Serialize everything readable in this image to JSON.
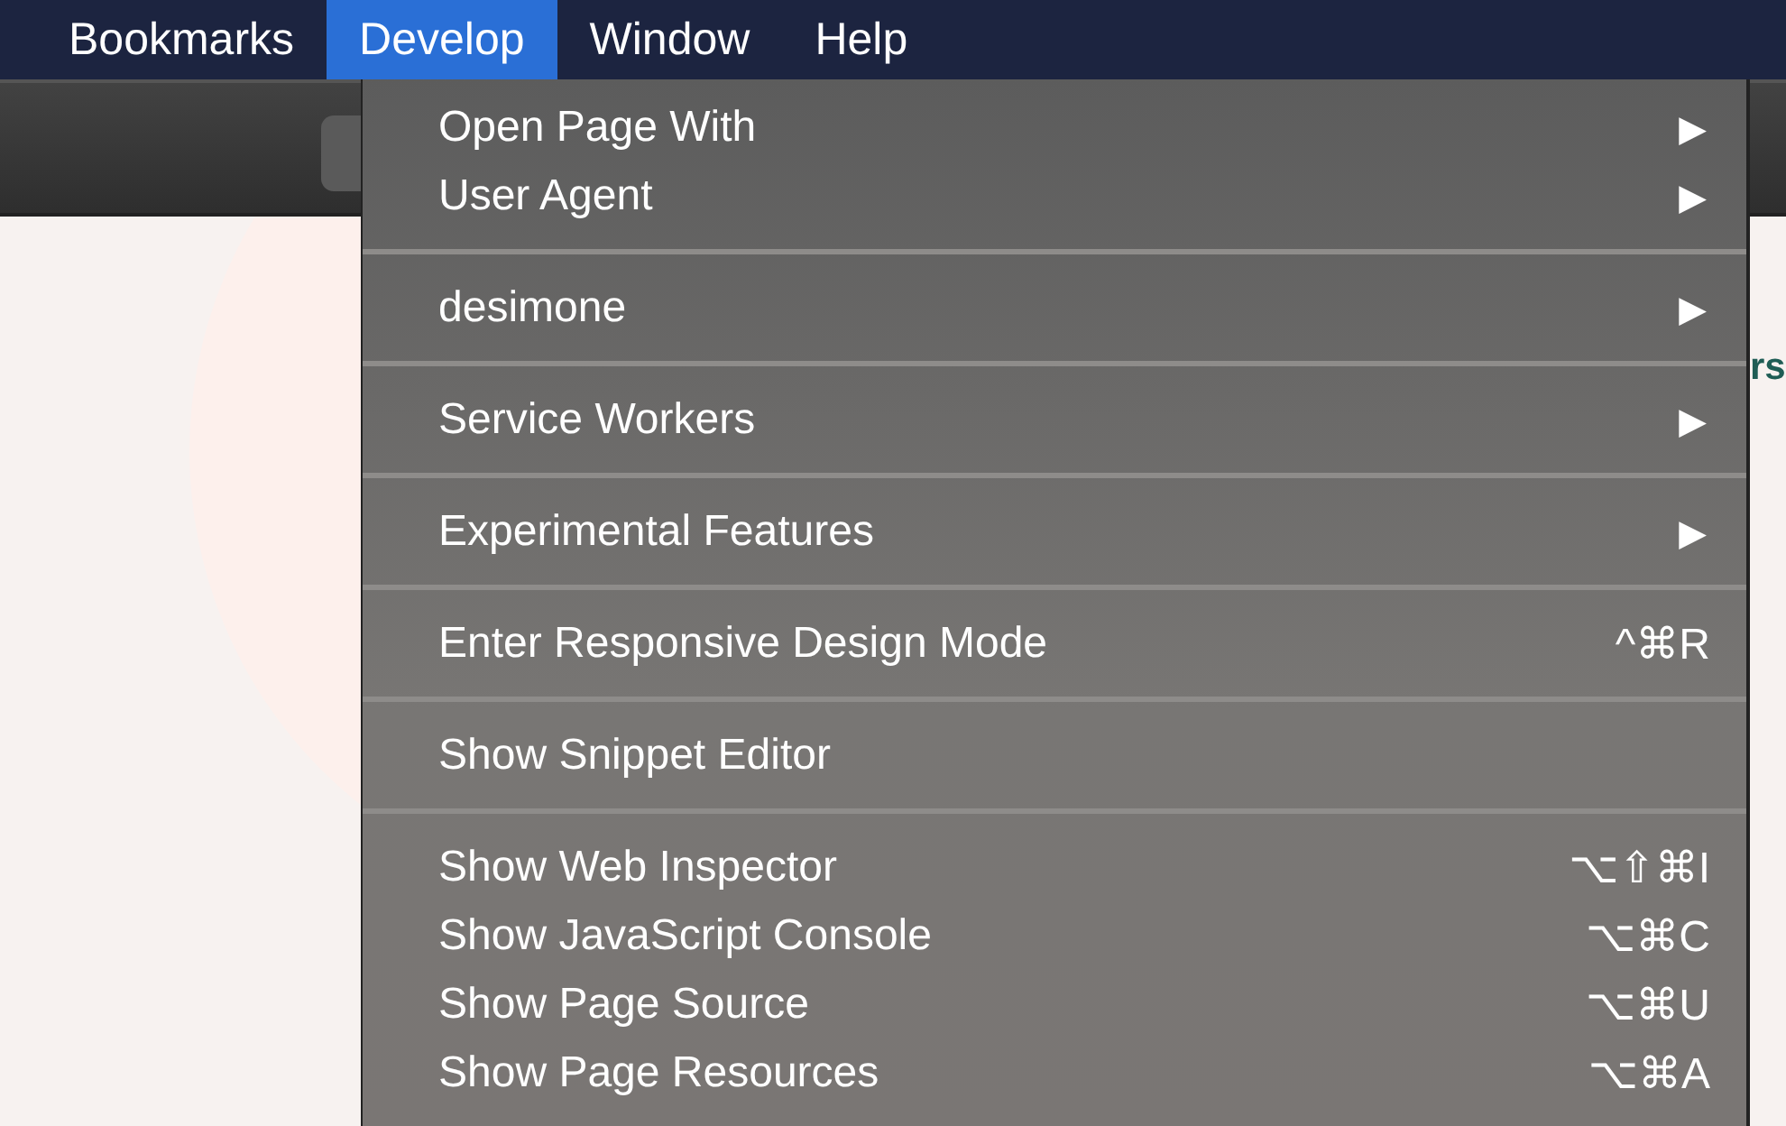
{
  "menu_bar": {
    "items": [
      {
        "label": "Bookmarks",
        "selected": false
      },
      {
        "label": "Develop",
        "selected": true
      },
      {
        "label": "Window",
        "selected": false
      },
      {
        "label": "Help",
        "selected": false
      }
    ]
  },
  "page": {
    "partial_text": "rs"
  },
  "develop_menu": {
    "groups": [
      {
        "items": [
          {
            "label": "Open Page With",
            "arrow": "▶"
          },
          {
            "label": "User Agent",
            "arrow": "▶"
          }
        ]
      },
      {
        "items": [
          {
            "label": "desimone",
            "arrow": "▶"
          }
        ]
      },
      {
        "items": [
          {
            "label": "Service Workers",
            "arrow": "▶"
          }
        ]
      },
      {
        "items": [
          {
            "label": "Experimental Features",
            "arrow": "▶"
          }
        ]
      },
      {
        "items": [
          {
            "label": "Enter Responsive Design Mode",
            "shortcut": "^⌘R"
          }
        ]
      },
      {
        "items": [
          {
            "label": "Show Snippet Editor"
          }
        ]
      },
      {
        "items": [
          {
            "label": "Show Web Inspector",
            "shortcut": "⌥⇧⌘I"
          },
          {
            "label": "Show JavaScript Console",
            "shortcut": "⌥⌘C"
          },
          {
            "label": "Show Page Source",
            "shortcut": "⌥⌘U"
          },
          {
            "label": "Show Page Resources",
            "shortcut": "⌥⌘A"
          }
        ]
      }
    ]
  }
}
